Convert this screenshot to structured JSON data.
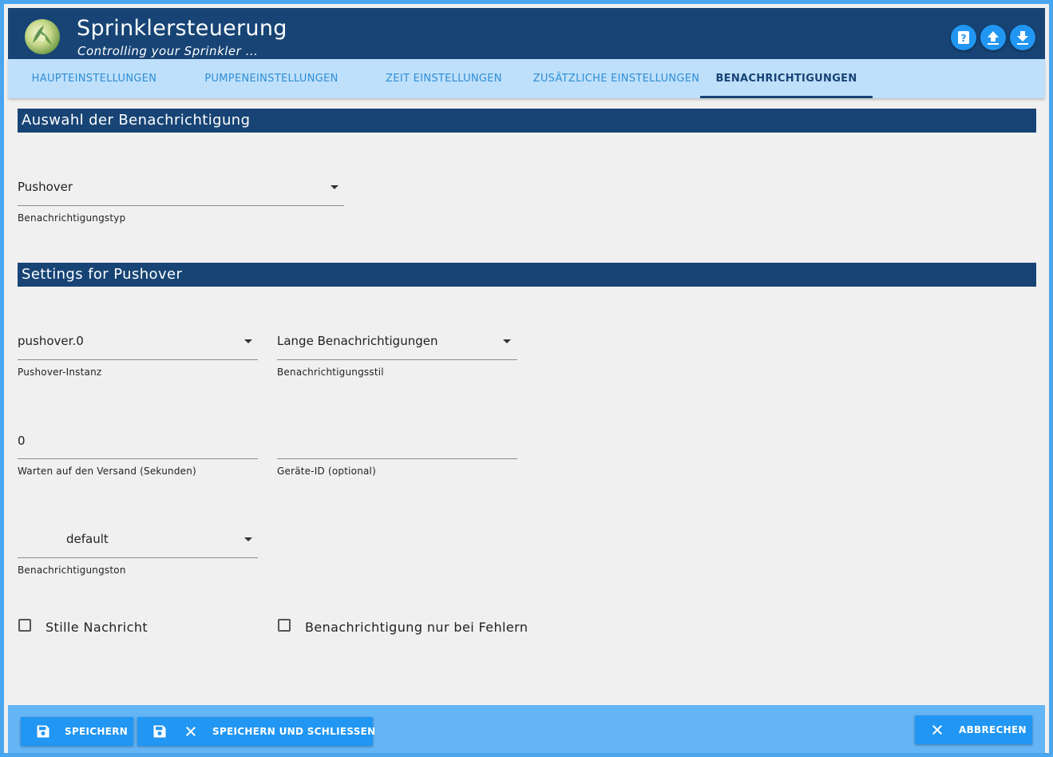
{
  "header": {
    "title": "Sprinklersteuerung",
    "subtitle": "Controlling your Sprinkler ...",
    "buttons": [
      {
        "icon": "help-book-icon"
      },
      {
        "icon": "upload-icon"
      },
      {
        "icon": "download-icon"
      }
    ]
  },
  "tabs": [
    {
      "label": "HAUPTEINSTELLUNGEN",
      "active": false
    },
    {
      "label": "PUMPENEINSTELLUNGEN",
      "active": false
    },
    {
      "label": "ZEIT EINSTELLUNGEN",
      "active": false
    },
    {
      "label": "ZUSÄTZLICHE EINSTELLUNGEN",
      "active": false
    },
    {
      "label": "BENACHRICHTIGUNGEN",
      "active": true
    }
  ],
  "section1": {
    "title": "Auswahl der Benachrichtigung",
    "notification_type": {
      "value": "Pushover",
      "label": "Benachrichtigungstyp"
    }
  },
  "section2": {
    "title": "Settings for Pushover",
    "instance": {
      "value": "pushover.0",
      "label": "Pushover-Instanz"
    },
    "style": {
      "value": "Lange Benachrichtigungen",
      "label": "Benachrichtigungsstil"
    },
    "wait": {
      "value": "0",
      "label": "Warten auf den Versand (Sekunden)"
    },
    "device_id": {
      "value": "",
      "label": "Geräte-ID (optional)"
    },
    "sound": {
      "value": "default",
      "label": "Benachrichtigungston"
    },
    "silent": {
      "label": "Stille Nachricht",
      "checked": false
    },
    "errors_only": {
      "label": "Benachrichtigung nur bei Fehlern",
      "checked": false
    }
  },
  "footer": {
    "save": "SPEICHERN",
    "save_close": "SPEICHERN UND SCHLIESSEN",
    "cancel": "ABBRECHEN"
  },
  "colors": {
    "primary": "#174475",
    "accent": "#2196f3",
    "tabbar": "#bfe0fb",
    "footer": "#64b5f6",
    "background": "#f0f0f0"
  }
}
